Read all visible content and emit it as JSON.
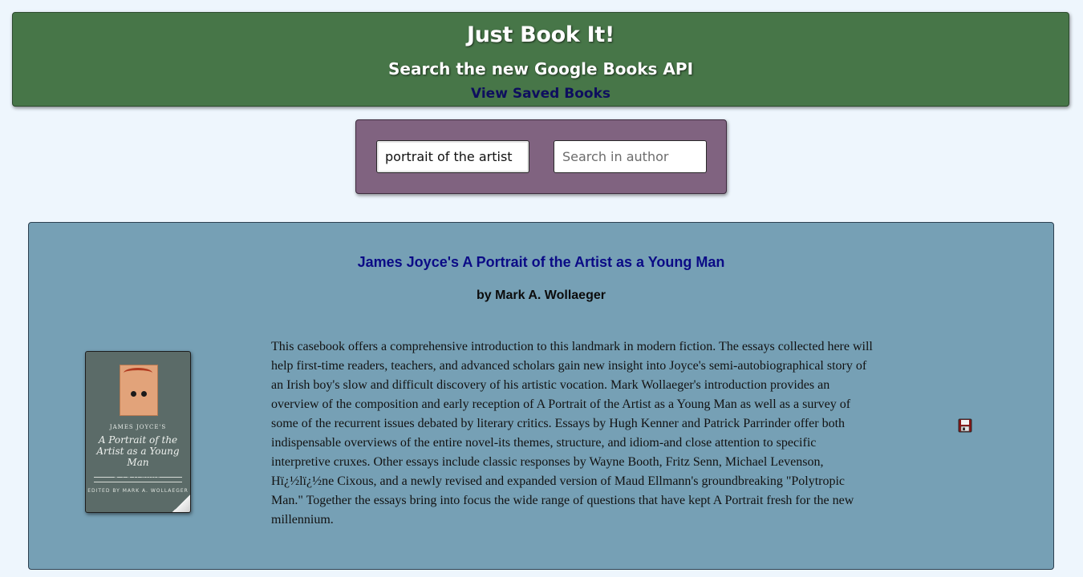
{
  "header": {
    "title": "Just Book It!",
    "subtitle": "Search the new Google Books API",
    "saved_link": "View Saved Books"
  },
  "search": {
    "title_value": "portrait of the artist",
    "author_placeholder": "Search in author"
  },
  "result": {
    "title": "James Joyce's A Portrait of the Artist as a Young Man",
    "author": "by Mark A. Wollaeger",
    "description": "This casebook offers a comprehensive introduction to this landmark in modern fiction. The essays collected here will help first-time readers, teachers, and advanced scholars gain new insight into Joyce's semi-autobiographical story of an Irish boy's slow and difficult discovery of his artistic vocation. Mark Wollaeger's introduction provides an overview of the composition and early reception of A Portrait of the Artist as a Young Man as well as a survey of some of the recurrent issues debated by literary critics. Essays by Hugh Kenner and Patrick Parrinder offer both indispensable overviews of the entire novel-its themes, structure, and idiom-and close attention to specific interpretive cruxes. Other essays include classic responses by Wayne Booth, Fritz Senn, Michael Levenson, Hï¿½lï¿½ne Cixous, and a newly revised and expanded version of Maud Ellmann's groundbreaking \"Polytropic Man.\" Together the essays bring into focus the wide range of questions that have kept A Portrait fresh for the new millennium.",
    "cover": {
      "author_line": "JAMES JOYCE'S",
      "title_line": "A Portrait of the Artist as a Young Man",
      "series_line": "A CASEBOOK",
      "editor_line": "EDITED BY MARK A. WOLLAEGER"
    },
    "save_icon": "floppy-disk-icon"
  },
  "colors": {
    "background": "#eef6fd",
    "header_bg": "#477648",
    "search_panel_bg": "#806380",
    "card_bg": "#76a0b5",
    "title_color": "#0b0b86",
    "link_color": "#0e0e5e"
  }
}
